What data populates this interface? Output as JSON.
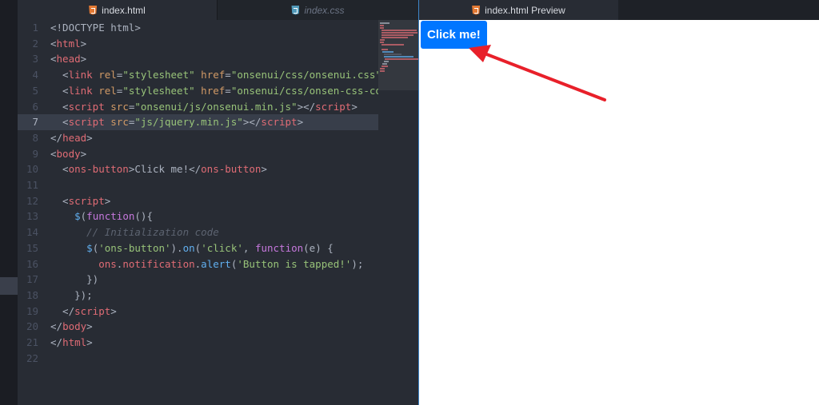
{
  "editor": {
    "tabs": [
      {
        "label": "index.html",
        "icon": "html5-icon",
        "active": true
      },
      {
        "label": "index.css",
        "icon": "css3-icon",
        "active": false
      }
    ],
    "current_line": 7,
    "lines": [
      {
        "n": "1",
        "segs": [
          {
            "c": "plain",
            "t": "<!DOCTYPE html>"
          }
        ]
      },
      {
        "n": "2",
        "segs": [
          {
            "c": "plain",
            "t": "<"
          },
          {
            "c": "tag",
            "t": "html"
          },
          {
            "c": "plain",
            "t": ">"
          }
        ]
      },
      {
        "n": "3",
        "segs": [
          {
            "c": "plain",
            "t": "<"
          },
          {
            "c": "tag",
            "t": "head"
          },
          {
            "c": "plain",
            "t": ">"
          }
        ]
      },
      {
        "n": "4",
        "segs": [
          {
            "c": "plain",
            "t": "  <"
          },
          {
            "c": "tag",
            "t": "link"
          },
          {
            "c": "plain",
            "t": " "
          },
          {
            "c": "attr",
            "t": "rel"
          },
          {
            "c": "plain",
            "t": "="
          },
          {
            "c": "str",
            "t": "\"stylesheet\""
          },
          {
            "c": "plain",
            "t": " "
          },
          {
            "c": "attr",
            "t": "href"
          },
          {
            "c": "plain",
            "t": "="
          },
          {
            "c": "str",
            "t": "\"onsenui/css/onsenui.css\""
          },
          {
            "c": "plain",
            "t": ">"
          }
        ]
      },
      {
        "n": "5",
        "segs": [
          {
            "c": "plain",
            "t": "  <"
          },
          {
            "c": "tag",
            "t": "link"
          },
          {
            "c": "plain",
            "t": " "
          },
          {
            "c": "attr",
            "t": "rel"
          },
          {
            "c": "plain",
            "t": "="
          },
          {
            "c": "str",
            "t": "\"stylesheet\""
          },
          {
            "c": "plain",
            "t": " "
          },
          {
            "c": "attr",
            "t": "href"
          },
          {
            "c": "plain",
            "t": "="
          },
          {
            "c": "str",
            "t": "\"onsenui/css/onsen-css-comp"
          }
        ]
      },
      {
        "n": "6",
        "segs": [
          {
            "c": "plain",
            "t": "  <"
          },
          {
            "c": "tag",
            "t": "script"
          },
          {
            "c": "plain",
            "t": " "
          },
          {
            "c": "attr",
            "t": "src"
          },
          {
            "c": "plain",
            "t": "="
          },
          {
            "c": "str",
            "t": "\"onsenui/js/onsenui.min.js\""
          },
          {
            "c": "plain",
            "t": "></"
          },
          {
            "c": "tag",
            "t": "script"
          },
          {
            "c": "plain",
            "t": ">"
          }
        ]
      },
      {
        "n": "7",
        "segs": [
          {
            "c": "plain",
            "t": "  <"
          },
          {
            "c": "tag",
            "t": "script"
          },
          {
            "c": "plain",
            "t": " "
          },
          {
            "c": "attr",
            "t": "src"
          },
          {
            "c": "plain",
            "t": "="
          },
          {
            "c": "str",
            "t": "\"js/jquery.min.js\""
          },
          {
            "c": "plain",
            "t": "></"
          },
          {
            "c": "tag",
            "t": "script"
          },
          {
            "c": "plain",
            "t": ">"
          }
        ]
      },
      {
        "n": "8",
        "segs": [
          {
            "c": "plain",
            "t": "</"
          },
          {
            "c": "tag",
            "t": "head"
          },
          {
            "c": "plain",
            "t": ">"
          }
        ]
      },
      {
        "n": "9",
        "segs": [
          {
            "c": "plain",
            "t": "<"
          },
          {
            "c": "tag",
            "t": "body"
          },
          {
            "c": "plain",
            "t": ">"
          }
        ]
      },
      {
        "n": "10",
        "segs": [
          {
            "c": "plain",
            "t": "  <"
          },
          {
            "c": "tag",
            "t": "ons-button"
          },
          {
            "c": "plain",
            "t": ">Click me!</"
          },
          {
            "c": "tag",
            "t": "ons-button"
          },
          {
            "c": "plain",
            "t": ">"
          }
        ]
      },
      {
        "n": "11",
        "segs": []
      },
      {
        "n": "12",
        "segs": [
          {
            "c": "plain",
            "t": "  <"
          },
          {
            "c": "tag",
            "t": "script"
          },
          {
            "c": "plain",
            "t": ">"
          }
        ]
      },
      {
        "n": "13",
        "segs": [
          {
            "c": "plain",
            "t": "    "
          },
          {
            "c": "fn",
            "t": "$"
          },
          {
            "c": "plain",
            "t": "("
          },
          {
            "c": "kw",
            "t": "function"
          },
          {
            "c": "plain",
            "t": "(){"
          }
        ]
      },
      {
        "n": "14",
        "segs": [
          {
            "c": "plain",
            "t": "      "
          },
          {
            "c": "cm",
            "t": "// Initialization code"
          }
        ]
      },
      {
        "n": "15",
        "segs": [
          {
            "c": "plain",
            "t": "      "
          },
          {
            "c": "fn",
            "t": "$"
          },
          {
            "c": "plain",
            "t": "("
          },
          {
            "c": "str",
            "t": "'ons-button'"
          },
          {
            "c": "plain",
            "t": ")."
          },
          {
            "c": "fn",
            "t": "on"
          },
          {
            "c": "plain",
            "t": "("
          },
          {
            "c": "str",
            "t": "'click'"
          },
          {
            "c": "plain",
            "t": ", "
          },
          {
            "c": "kw",
            "t": "function"
          },
          {
            "c": "plain",
            "t": "(e) {"
          }
        ]
      },
      {
        "n": "16",
        "segs": [
          {
            "c": "plain",
            "t": "        "
          },
          {
            "c": "tag",
            "t": "ons"
          },
          {
            "c": "plain",
            "t": "."
          },
          {
            "c": "tag",
            "t": "notification"
          },
          {
            "c": "plain",
            "t": "."
          },
          {
            "c": "fn",
            "t": "alert"
          },
          {
            "c": "plain",
            "t": "("
          },
          {
            "c": "str",
            "t": "'Button is tapped!'"
          },
          {
            "c": "plain",
            "t": ");"
          }
        ]
      },
      {
        "n": "17",
        "segs": [
          {
            "c": "plain",
            "t": "      })"
          }
        ]
      },
      {
        "n": "18",
        "segs": [
          {
            "c": "plain",
            "t": "    });"
          }
        ]
      },
      {
        "n": "19",
        "segs": [
          {
            "c": "plain",
            "t": "  </"
          },
          {
            "c": "tag",
            "t": "script"
          },
          {
            "c": "plain",
            "t": ">"
          }
        ]
      },
      {
        "n": "20",
        "segs": [
          {
            "c": "plain",
            "t": "</"
          },
          {
            "c": "tag",
            "t": "body"
          },
          {
            "c": "plain",
            "t": ">"
          }
        ]
      },
      {
        "n": "21",
        "segs": [
          {
            "c": "plain",
            "t": "</"
          },
          {
            "c": "tag",
            "t": "html"
          },
          {
            "c": "plain",
            "t": ">"
          }
        ]
      },
      {
        "n": "22",
        "segs": []
      }
    ]
  },
  "preview": {
    "tab_label": "index.html Preview",
    "tab_icon": "html5-icon",
    "button_label": "Click me!",
    "button_color": "#0076ff",
    "annotation_color": "#e8202a"
  },
  "theme": {
    "tag": "#e06c75",
    "attr": "#d19a66",
    "string": "#98c379",
    "keyword": "#c678dd",
    "function": "#61afef",
    "comment": "#5c6370"
  }
}
